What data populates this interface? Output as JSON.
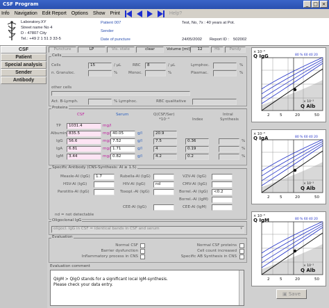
{
  "window": {
    "title": "CSF Program"
  },
  "menu": {
    "items": [
      "Info",
      "Navigation",
      "Edit Report",
      "Options",
      "Show",
      "Print"
    ],
    "help": "Help?"
  },
  "header": {
    "lab_lines": [
      "Laboratory.XY",
      "Street name No 4",
      "D - 47807 City",
      "Tel.: +49 2 1 51 3 33-5"
    ],
    "patient": "Patient 007",
    "test": "Test, No, 7x : 40 years at Pot.",
    "sender": "Sender",
    "date_label": "Date of puncture",
    "date_value": "24/05/2002",
    "report_label": "Report ID :",
    "report_value": "502002"
  },
  "tabs": [
    "CSF",
    "Patient",
    "Special analysis",
    "Sender",
    "Antibody"
  ],
  "toolbar": {
    "puncture": "Puncture",
    "lp": "LP",
    "vis_state": "Vis. state",
    "clear": "clear",
    "volume_label": "Volume [ml]",
    "volume_value": "12",
    "hb": "Hb",
    "pandy": "Pandy"
  },
  "cells": {
    "title": "Cells",
    "cells_label": "Cells",
    "cells_value": "15",
    "cells_unit": "/ µL",
    "rbc_label": "RBC",
    "rbc_value": "8",
    "rbc_unit": "/ µL",
    "lymphoc_label": "Lymphoc.",
    "granuloc_label": "n. Granuloc.",
    "monoc_label": "Monoc.",
    "plasmac_label": "Plasmac.",
    "pct": "%",
    "other_label": "other cells",
    "actblymph_label": "Act. B-Lymph.",
    "pct_lymphoc": "% Lymphoc.",
    "rbc_qual": "RBC qualitative"
  },
  "proteins": {
    "title": "Proteins",
    "col_csf": "CSF",
    "col_serum": "Serum",
    "col_q": "Q(CSF/Ser)",
    "col_q_exp": "*10⁻³",
    "col_index": "Index",
    "col_intrathecal": "Intral",
    "col_synthesis": "Synthesis",
    "rows": [
      {
        "name": "TP",
        "csf": "1031.4",
        "csf_unit": "mg/l",
        "serum": "",
        "serum_unit": "",
        "q": "",
        "index": "",
        "syn": ""
      },
      {
        "name": "Albumin",
        "csf": "835.5",
        "csf_unit": "mg/l",
        "serum": "40.05",
        "serum_unit": "g/l",
        "q": "20.9",
        "index": "",
        "syn": ""
      },
      {
        "name": "IgG",
        "csf": "56.6",
        "csf_unit": "mg/l",
        "serum": "7.52",
        "serum_unit": "g/l",
        "q": "7.5",
        "index": "0.36",
        "syn": ""
      },
      {
        "name": "IgA",
        "csf": "6.81",
        "csf_unit": "mg/l",
        "serum": "1.71",
        "serum_unit": "g/l",
        "q": "4",
        "index": "0.19",
        "syn": ""
      },
      {
        "name": "IgM",
        "csf": "3.44",
        "csf_unit": "mg/l",
        "serum": "0.82",
        "serum_unit": "g/l",
        "q": "4.2",
        "index": "0.2",
        "syn": ""
      }
    ],
    "pct": "%"
  },
  "antibody": {
    "title": "Specific Antibody (CNS-Synthesis: AI ≥ 1.5)",
    "items": [
      {
        "label": "Measle-AI (IgG)",
        "value": "1.7"
      },
      {
        "label": "Rubella-AI (IgG)",
        "value": ""
      },
      {
        "label": "VZV-AI (IgG)",
        "value": ""
      },
      {
        "label": "HSV-AI (IgG)",
        "value": ""
      },
      {
        "label": "HIV-AI (IgG)",
        "value": "nd"
      },
      {
        "label": "CMV-AI (IgG)",
        "value": ""
      },
      {
        "label": "Parotitis-AI (IgG)",
        "value": ""
      },
      {
        "label": "Toxopl.-AI (IgG)",
        "value": ""
      },
      {
        "label": "Borrel.-AI (IgG)",
        "value": "<0.2"
      },
      {
        "label": "Borrel.-AI (IgM)",
        "value": ""
      },
      {
        "label": "CEE-AI (IgG)",
        "value": ""
      },
      {
        "label": "CEE-AI (IgM)",
        "value": ""
      }
    ],
    "footnote": "nd = not detectable"
  },
  "oligoclonal": {
    "title": "Oligoclonal IgG",
    "value": "oligocl. IgG in CSF = identical bands in CSF and serum"
  },
  "evaluation": {
    "title": "Evaluation",
    "left": [
      "Normal CSF",
      "Barrier dysfunction",
      "Inflammatory process in CNS"
    ],
    "right": [
      "Normal CSF proteins",
      "Cell count increased",
      "Specific AB Synthesis in CNS"
    ]
  },
  "comment": {
    "title": "Evaluation comment",
    "lines": [
      "QIgM > QIgO stands for a significant local IgM-synthesis.",
      "Please check your data entry."
    ]
  },
  "graphs": [
    {
      "ylabel": "Q IgG",
      "exp": "× 10⁻³",
      "xlabel": "Q Alb",
      "pcts": "80 % 60 40 20",
      "ticks": [
        "2",
        "5",
        "20",
        "50"
      ]
    },
    {
      "ylabel": "Q IgA",
      "exp": "× 10⁻³",
      "xlabel": "Q Alb",
      "pcts": "80 % 60 40 20",
      "ticks": [
        "2",
        "5",
        "20",
        "50"
      ]
    },
    {
      "ylabel": "Q IgM",
      "exp": "× 10⁻³",
      "xlabel": "Q Alb",
      "pcts": "80 % 60 40 20",
      "ticks": [
        "2",
        "5",
        "20",
        "50"
      ]
    }
  ],
  "save_label": "Save",
  "colors": {
    "titlebar": "#2a50b0",
    "nav_arrow": "#1a2bd0",
    "pink_field": "#fde4f4",
    "unit": "#c020a0",
    "curve": "#2020c0"
  }
}
